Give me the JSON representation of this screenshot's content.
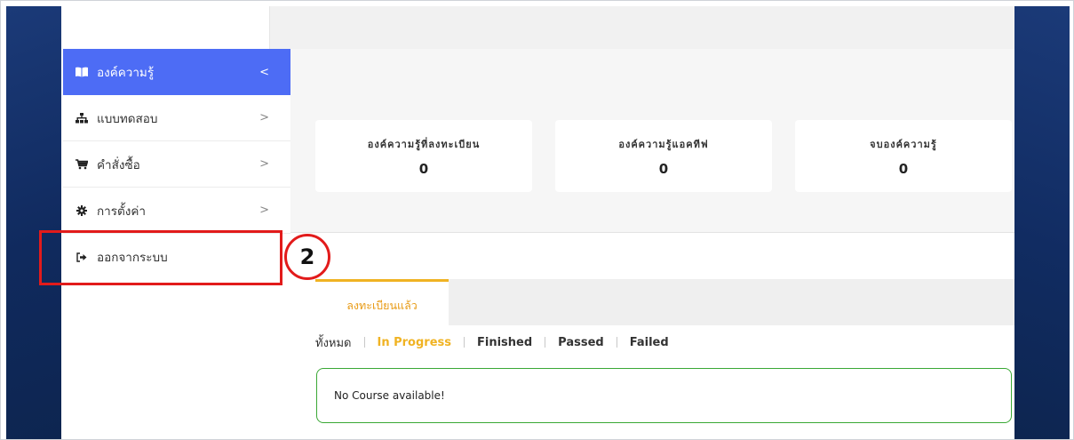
{
  "sidebar": {
    "items": [
      {
        "label": "องค์ความรู้",
        "icon": "book-icon",
        "chevron": "<",
        "active": true
      },
      {
        "label": "แบบทดสอบ",
        "icon": "sitemap-icon",
        "chevron": ">"
      },
      {
        "label": "คำสั่งซื้อ",
        "icon": "cart-icon",
        "chevron": ">"
      },
      {
        "label": "การตั้งค่า",
        "icon": "gear-icon",
        "chevron": ">"
      },
      {
        "label": "ออกจากระบบ",
        "icon": "sign-out-icon"
      }
    ]
  },
  "annotation": {
    "badge": "2",
    "color": "#e21b1b"
  },
  "stats": [
    {
      "label": "องค์ความรู้ที่ลงทะเบียน",
      "value": "0"
    },
    {
      "label": "องค์ความรู้แอคทีฟ",
      "value": "0"
    },
    {
      "label": "จบองค์ความรู้",
      "value": "0"
    }
  ],
  "tabs": {
    "active_label": "ลงทะเบียนแล้ว"
  },
  "filters": [
    "ทั้งหมด",
    "In Progress",
    "Finished",
    "Passed",
    "Failed"
  ],
  "empty_message": "No Course available!",
  "colors": {
    "accent": "#4d6cf5",
    "tab_active": "#f0b323",
    "alert_border": "#3aa835",
    "frame": "#102a5e"
  }
}
